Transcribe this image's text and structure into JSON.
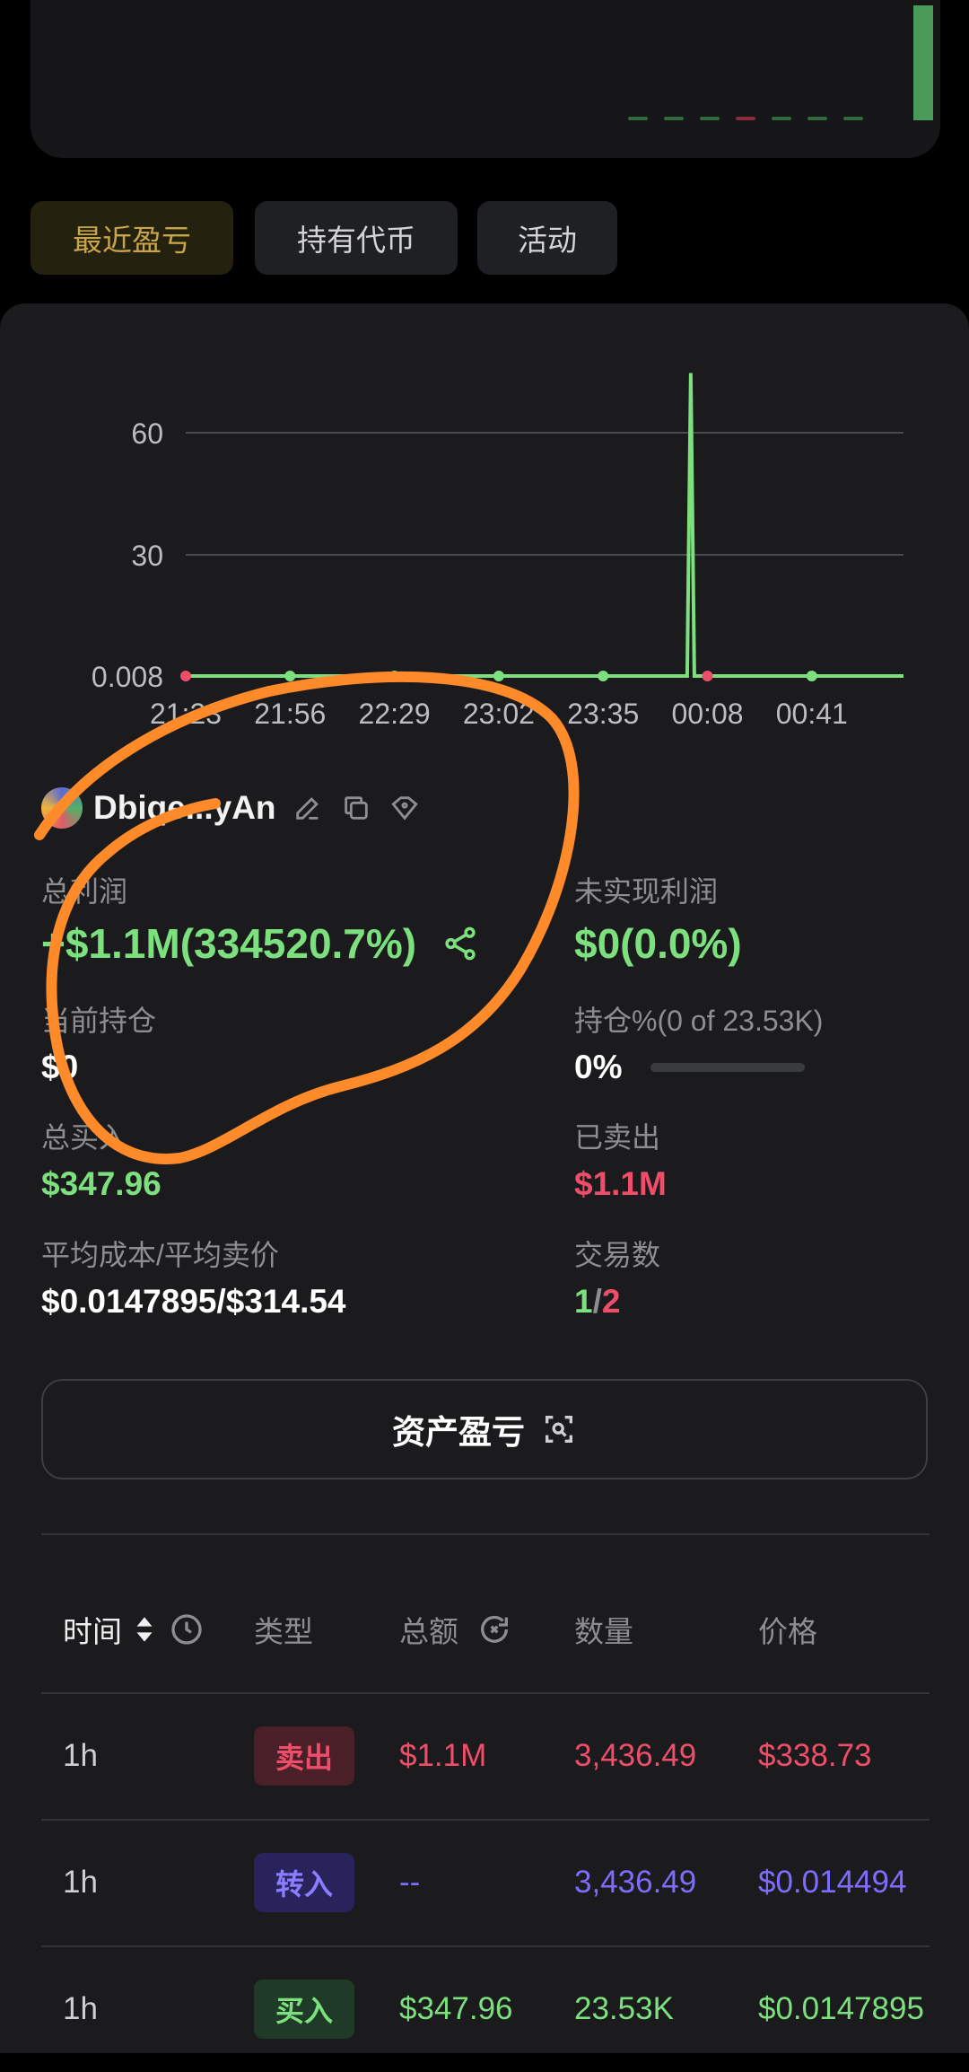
{
  "colors": {
    "profit": "#7ce07e",
    "loss": "#ef4e6a",
    "transfer": "#7c6dff",
    "accent": "#c8a54a",
    "annotation": "#ff8a2a"
  },
  "tabs": [
    {
      "label": "最近盈亏",
      "active": true
    },
    {
      "label": "持有代币",
      "active": false
    },
    {
      "label": "活动",
      "active": false
    }
  ],
  "chart_data": {
    "type": "line",
    "x": [
      "21:23",
      "21:56",
      "22:29",
      "23:02",
      "23:35",
      "00:08",
      "00:41"
    ],
    "y_ticks": [
      "60",
      "30",
      "0.008"
    ],
    "ylim": [
      0.008,
      75
    ],
    "series": [
      {
        "values": [
          0.008,
          0.008,
          0.008,
          0.008,
          0.008,
          0.008,
          0.008
        ],
        "spike": {
          "between": [
            "23:35",
            "00:08"
          ],
          "value": 75
        }
      }
    ],
    "marker_colors": [
      "loss",
      "profit",
      "profit",
      "profit",
      "profit",
      "loss",
      "profit"
    ],
    "grid": true
  },
  "owner": {
    "name": "Dbiqe...yAn",
    "icons": [
      "edit-icon",
      "copy-icon",
      "tag-icon"
    ]
  },
  "stats": {
    "total_profit": {
      "label": "总利润",
      "value": "+$1.1M(334520.7%)"
    },
    "unrealized": {
      "label": "未实现利润",
      "value": "$0(0.0%)"
    },
    "position": {
      "label": "当前持仓",
      "value": "$0"
    },
    "holding_pct": {
      "label": "持仓%(0 of 23.53K)",
      "value": "0%",
      "fill": 0
    },
    "total_buy": {
      "label": "总买入",
      "value": "$347.96"
    },
    "sold": {
      "label": "已卖出",
      "value": "$1.1M"
    },
    "avg_cost": {
      "label": "平均成本/平均卖价",
      "value": "$0.0147895/$314.54"
    },
    "trades": {
      "label": "交易数",
      "buy": "1",
      "sep": "/",
      "sell": "2"
    }
  },
  "asset_button": {
    "label": "资产盈亏"
  },
  "table": {
    "headers": [
      "时间",
      "类型",
      "总额",
      "数量",
      "价格"
    ],
    "rows": [
      {
        "time": "1h",
        "type": "卖出",
        "kind": "sell",
        "total": "$1.1M",
        "qty": "3,436.49",
        "price": "$338.73"
      },
      {
        "time": "1h",
        "type": "转入",
        "kind": "transfer",
        "total": "--",
        "qty": "3,436.49",
        "price": "$0.014494"
      },
      {
        "time": "1h",
        "type": "买入",
        "kind": "buy",
        "total": "$347.96",
        "qty": "23.53K",
        "price": "$0.0147895"
      }
    ]
  }
}
